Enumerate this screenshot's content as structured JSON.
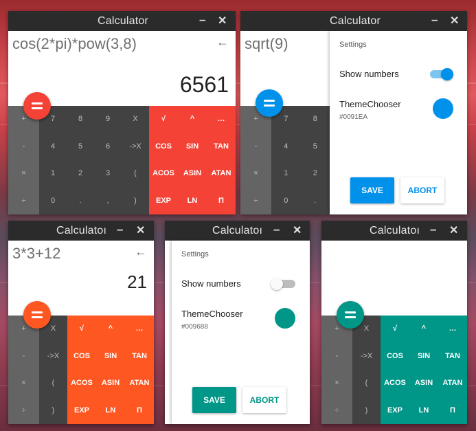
{
  "windows": [
    {
      "title": "Calculator",
      "expression": "cos(2*pi)*pow(3,8)",
      "result": "6561",
      "accent": "#F44336",
      "ops": [
        "+",
        "-",
        "×",
        "÷"
      ],
      "nums": [
        [
          "7",
          "8",
          "9",
          "X"
        ],
        [
          "4",
          "5",
          "6",
          "->X"
        ],
        [
          "1",
          "2",
          "3",
          "("
        ],
        [
          "0",
          ".",
          ",",
          ")"
        ]
      ],
      "adv": [
        [
          "√",
          "^",
          "…"
        ],
        [
          "COS",
          "SIN",
          "TAN"
        ],
        [
          "ACOS",
          "ASIN",
          "ATAN"
        ],
        [
          "EXP",
          "LN",
          "Π"
        ]
      ]
    },
    {
      "title": "Calculator",
      "expression": "sqrt(9)",
      "accent": "#0091EA",
      "ops": [
        "+",
        "-",
        "×",
        "÷"
      ],
      "nums": [
        [
          "7",
          "8"
        ],
        [
          "4",
          "5"
        ],
        [
          "1",
          "2"
        ],
        [
          "0",
          "."
        ]
      ],
      "settings": {
        "heading": "Settings",
        "show_numbers": "Show numbers",
        "theme_chooser": "ThemeChooser",
        "theme_value": "#0091EA",
        "save": "SAVE",
        "abort": "ABORT"
      }
    },
    {
      "title": "Calculatoı",
      "expression": "3*3+12",
      "result": "21",
      "accent": "#FF5722",
      "ops": [
        "+",
        "-",
        "×",
        "÷"
      ],
      "nums": [
        [
          "X"
        ],
        [
          "->X"
        ],
        [
          "("
        ],
        [
          ")"
        ]
      ],
      "adv": [
        [
          "√",
          "^",
          "…"
        ],
        [
          "COS",
          "SIN",
          "TAN"
        ],
        [
          "ACOS",
          "ASIN",
          "ATAN"
        ],
        [
          "EXP",
          "LN",
          "Π"
        ]
      ]
    },
    {
      "title": "Calculatoı",
      "accent": "#009688",
      "settings": {
        "heading": "Settings",
        "show_numbers": "Show numbers",
        "theme_chooser": "ThemeChooser",
        "theme_value": "#009688",
        "save": "SAVE",
        "abort": "ABORT"
      }
    },
    {
      "title": "Calculatoı",
      "accent": "#009688",
      "ops": [
        "+",
        "-",
        "×",
        "÷"
      ],
      "nums": [
        [
          "X"
        ],
        [
          "->X"
        ],
        [
          "("
        ],
        [
          ")"
        ]
      ],
      "adv": [
        [
          "√",
          "^",
          "…"
        ],
        [
          "COS",
          "SIN",
          "TAN"
        ],
        [
          "ACOS",
          "ASIN",
          "ATAN"
        ],
        [
          "EXP",
          "LN",
          "Π"
        ]
      ]
    }
  ],
  "controls": {
    "minimize": "–",
    "close": "✕",
    "backspace": "←"
  }
}
